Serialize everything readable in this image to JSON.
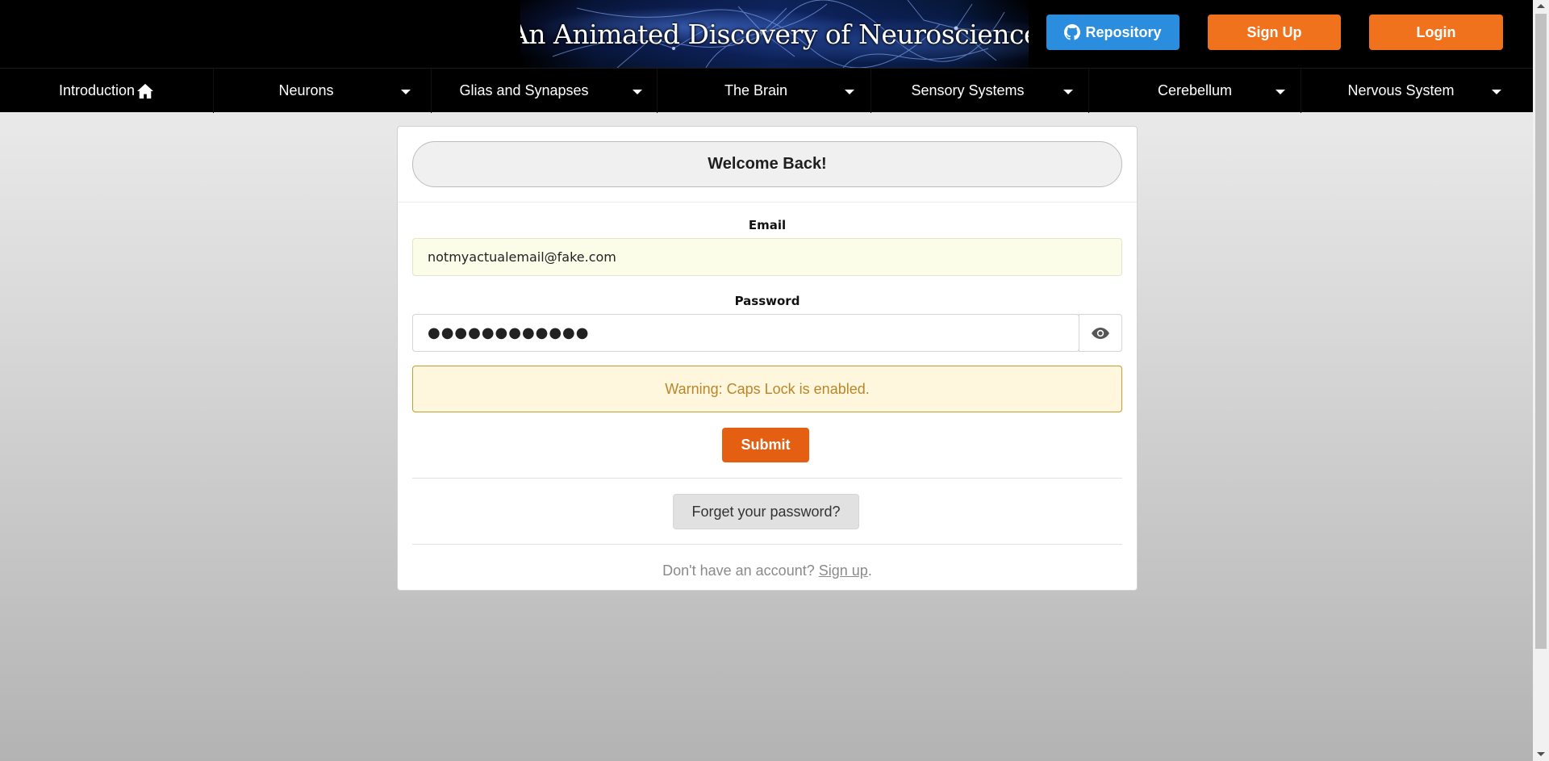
{
  "header": {
    "banner_title": "An Animated Discovery of Neuroscience",
    "repository_label": "Repository",
    "signup_label": "Sign Up",
    "login_label": "Login",
    "repository_icon": "github-icon",
    "colors": {
      "repository_button": "#2b8dde",
      "signup_button": "#f0721c",
      "login_button": "#f0721c"
    }
  },
  "nav": {
    "items": [
      {
        "label": "Introduction",
        "icon": "home-icon",
        "has_dropdown": false
      },
      {
        "label": "Neurons",
        "has_dropdown": true
      },
      {
        "label": "Glias and Synapses",
        "has_dropdown": true
      },
      {
        "label": "The Brain",
        "has_dropdown": true
      },
      {
        "label": "Sensory Systems",
        "has_dropdown": true
      },
      {
        "label": "Cerebellum",
        "has_dropdown": true
      },
      {
        "label": "Nervous System",
        "has_dropdown": true
      }
    ]
  },
  "login_form": {
    "heading": "Welcome Back!",
    "email_label": "Email",
    "email_value": "notmyactualemail@fake.com",
    "password_label": "Password",
    "password_value": "●●●●●●●●●●●●",
    "show_password_icon": "eye-icon",
    "warning": "Warning: Caps Lock is enabled.",
    "submit_label": "Submit",
    "forgot_label": "Forget your password?",
    "signup_prompt": "Don't have an account?",
    "signup_link": "Sign up",
    "signup_suffix": ".",
    "colors": {
      "submit_button": "#e55f12",
      "warning_bg": "#fef7dd",
      "warning_text": "#b8862a"
    }
  }
}
